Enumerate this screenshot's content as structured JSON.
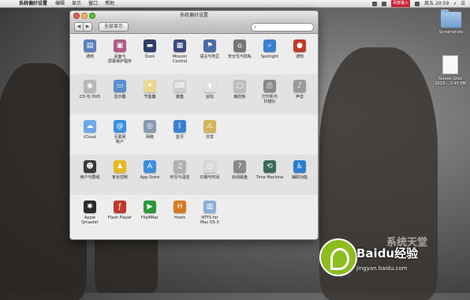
{
  "menubar": {
    "app_name": "系统偏好设置",
    "menus": [
      "编辑",
      "显示",
      "窗口",
      "帮助"
    ],
    "ime": "百度输入",
    "clock": "周五 20:59"
  },
  "window": {
    "title": "系统偏好设置",
    "show_all": "全部显示",
    "search_placeholder": ""
  },
  "sections": [
    {
      "items": [
        {
          "label": "通用",
          "icon": "general-icon",
          "color": "#5b7fbd",
          "glyph": "▤"
        },
        {
          "label": "桌面与\n屏幕保护程序",
          "icon": "desktop-screensaver-icon",
          "color": "#b05a8a",
          "glyph": "▣"
        },
        {
          "label": "Dock",
          "icon": "dock-icon",
          "color": "#2d3e6b",
          "glyph": "▬"
        },
        {
          "label": "Mission\nControl",
          "icon": "mission-control-icon",
          "color": "#3a4a7a",
          "glyph": "▦"
        },
        {
          "label": "语言与地区",
          "icon": "language-region-icon",
          "color": "#4a6ca8",
          "glyph": "⚑"
        },
        {
          "label": "安全性与隐私",
          "icon": "security-privacy-icon",
          "color": "#777777",
          "glyph": "⌂"
        },
        {
          "label": "Spotlight",
          "icon": "spotlight-icon",
          "color": "#3a7fd0",
          "glyph": "⌕"
        },
        {
          "label": "通知",
          "icon": "notifications-icon",
          "color": "#c0392b",
          "glyph": "●"
        }
      ]
    },
    {
      "items": [
        {
          "label": "CD 与 DVD",
          "icon": "cd-dvd-icon",
          "color": "#b8b8b8",
          "glyph": "◉"
        },
        {
          "label": "显示器",
          "icon": "displays-icon",
          "color": "#5a8fd0",
          "glyph": "▭"
        },
        {
          "label": "节能器",
          "icon": "energy-saver-icon",
          "color": "#e8d890",
          "glyph": "✦"
        },
        {
          "label": "键盘",
          "icon": "keyboard-icon",
          "color": "#cfcfcf",
          "glyph": "⌨"
        },
        {
          "label": "鼠标",
          "icon": "mouse-icon",
          "color": "#e0e0e0",
          "glyph": "◖"
        },
        {
          "label": "触控板",
          "icon": "trackpad-icon",
          "color": "#bdbdbd",
          "glyph": "▢"
        },
        {
          "label": "打印机与\n扫描仪",
          "icon": "printer-scanner-icon",
          "color": "#8a8a8a",
          "glyph": "⎙"
        },
        {
          "label": "声音",
          "icon": "sound-icon",
          "color": "#9a9a9a",
          "glyph": "♪"
        }
      ]
    },
    {
      "items": [
        {
          "label": "iCloud",
          "icon": "icloud-icon",
          "color": "#6fa8e8",
          "glyph": "☁"
        },
        {
          "label": "互联网\n帐户",
          "icon": "internet-accounts-icon",
          "color": "#3a8fe0",
          "glyph": "@"
        },
        {
          "label": "网络",
          "icon": "network-icon",
          "color": "#8a9ab0",
          "glyph": "◎"
        },
        {
          "label": "蓝牙",
          "icon": "bluetooth-icon",
          "color": "#3a7fd0",
          "glyph": "ᛒ"
        },
        {
          "label": "共享",
          "icon": "sharing-icon",
          "color": "#d4b45a",
          "glyph": "⚠"
        }
      ]
    },
    {
      "items": [
        {
          "label": "用户与群组",
          "icon": "users-groups-icon",
          "color": "#3a3a3a",
          "glyph": "☻"
        },
        {
          "label": "家长控制",
          "icon": "parental-controls-icon",
          "color": "#e8b820",
          "glyph": "♟"
        },
        {
          "label": "App Store",
          "icon": "app-store-icon",
          "color": "#3a8fe0",
          "glyph": "A"
        },
        {
          "label": "听写与语音",
          "icon": "dictation-speech-icon",
          "color": "#b0b0b0",
          "glyph": "♫"
        },
        {
          "label": "日期与时间",
          "icon": "date-time-icon",
          "color": "#d8d8d8",
          "glyph": "◷"
        },
        {
          "label": "启动磁盘",
          "icon": "startup-disk-icon",
          "color": "#8a8a8a",
          "glyph": "?"
        },
        {
          "label": "Time Machine",
          "icon": "time-machine-icon",
          "color": "#3a6a5a",
          "glyph": "⟲"
        },
        {
          "label": "辅助功能",
          "icon": "accessibility-icon",
          "color": "#2a7fd0",
          "glyph": "♿"
        }
      ]
    },
    {
      "items": [
        {
          "label": "Apple\nQmaster",
          "icon": "apple-qmaster-icon",
          "color": "#2a2a2a",
          "glyph": "✱"
        },
        {
          "label": "Flash Player",
          "icon": "flash-player-icon",
          "color": "#c0392b",
          "glyph": "ƒ"
        },
        {
          "label": "Flip4Mac",
          "icon": "flip4mac-icon",
          "color": "#2a9a3a",
          "glyph": "▶"
        },
        {
          "label": "Hosts",
          "icon": "hosts-icon",
          "color": "#d87a20",
          "glyph": "H"
        },
        {
          "label": "NTFS for\nMac OS X",
          "icon": "ntfs-icon",
          "color": "#8ab0d8",
          "glyph": "▥"
        }
      ]
    }
  ],
  "desktop": {
    "folder_label": "Screenshots",
    "file_label": "Screen Shot\n2013-...3.45 PM"
  },
  "watermark": {
    "brand": "Baidu经验",
    "url": "jingyan.baidu.com",
    "site": "系统天堂"
  }
}
